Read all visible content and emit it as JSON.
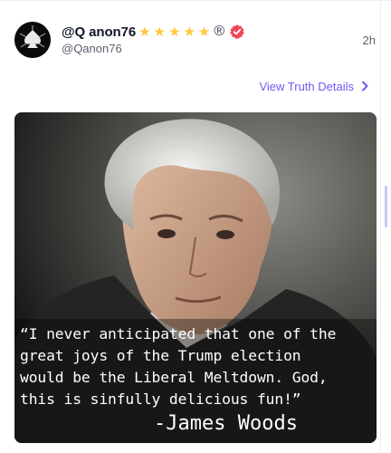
{
  "post": {
    "display_name": "@Q anon76",
    "badge_stars": [
      "★",
      "★",
      "★",
      "★",
      "★"
    ],
    "registered_mark": "®",
    "handle": "@Qanon76",
    "timestamp": "2h",
    "details_link": "View Truth Details",
    "media": {
      "quote": "“I never anticipated that one of the\ngreat joys of the Trump election\nwould be the Liberal Meltdown. God,\nthis is sinfully delicious fun!”",
      "author": "-James Woods"
    }
  },
  "colors": {
    "accent": "#6b5cf0",
    "verified_badge": "#f0475a",
    "star": "#ffc83d"
  }
}
